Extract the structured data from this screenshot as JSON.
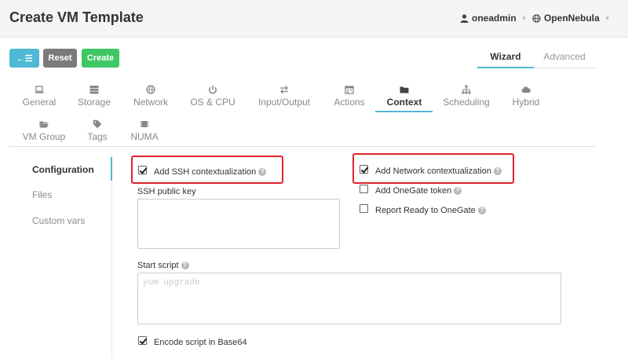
{
  "header": {
    "title": "Create VM Template",
    "user": "oneadmin",
    "zone": "OpenNebula"
  },
  "toolbar": {
    "back_label": "←☰",
    "reset_label": "Reset",
    "create_label": "Create"
  },
  "mode_tabs": {
    "wizard": "Wizard",
    "advanced": "Advanced",
    "active": "Wizard"
  },
  "tabs": [
    {
      "label": "General",
      "icon": "laptop-icon"
    },
    {
      "label": "Storage",
      "icon": "server-icon"
    },
    {
      "label": "Network",
      "icon": "globe-icon"
    },
    {
      "label": "OS & CPU",
      "icon": "power-icon"
    },
    {
      "label": "Input/Output",
      "icon": "exchange-icon"
    },
    {
      "label": "Actions",
      "icon": "calendar-icon"
    },
    {
      "label": "Context",
      "icon": "folder-icon",
      "active": true
    },
    {
      "label": "Scheduling",
      "icon": "sitemap-icon"
    },
    {
      "label": "Hybrid",
      "icon": "cloud-icon"
    },
    {
      "label": "VM Group",
      "icon": "folder-open-icon"
    },
    {
      "label": "Tags",
      "icon": "tag-icon"
    },
    {
      "label": "NUMA",
      "icon": "chip-icon"
    }
  ],
  "sidebar": {
    "items": [
      {
        "label": "Configuration",
        "active": true
      },
      {
        "label": "Files"
      },
      {
        "label": "Custom vars"
      }
    ]
  },
  "context": {
    "ssh_contextualization": {
      "label": "Add SSH contextualization",
      "checked": true
    },
    "ssh_public_key": {
      "label": "SSH public key",
      "value": ""
    },
    "network_contextualization": {
      "label": "Add Network contextualization",
      "checked": true
    },
    "onegate_token": {
      "label": "Add OneGate token",
      "checked": false
    },
    "report_ready": {
      "label": "Report Ready to OneGate",
      "checked": false
    },
    "start_script": {
      "label": "Start script",
      "placeholder": "yum upgrade",
      "value": ""
    },
    "encode_base64": {
      "label": "Encode script in Base64",
      "checked": true
    }
  },
  "colors": {
    "accent": "#4fb8d4",
    "create": "#3fc766",
    "reset": "#7a7a7a",
    "highlight": "#e0242e"
  }
}
